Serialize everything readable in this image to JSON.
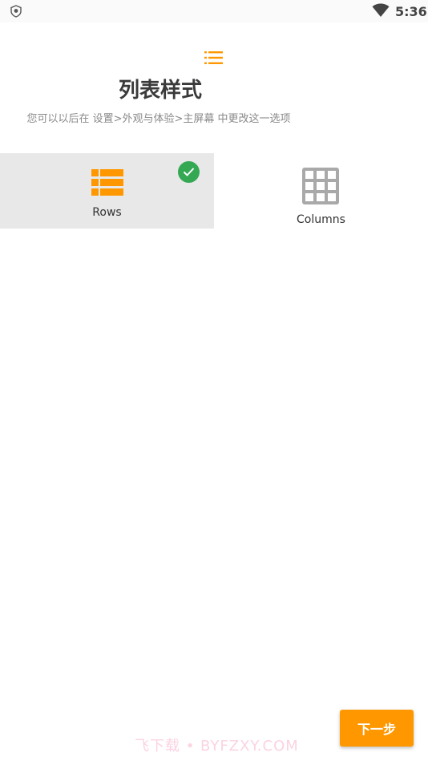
{
  "status_bar": {
    "time": "5:36",
    "left_icon": "shield-icon",
    "wifi_icon": "wifi-icon"
  },
  "header": {
    "icon": "list-icon",
    "title": "列表样式",
    "subtitle": "您可以以后在 设置>外观与体验>主屏幕 中更改这一选项"
  },
  "options": [
    {
      "label": "Rows",
      "icon": "rows-icon",
      "selected": true
    },
    {
      "label": "Columns",
      "icon": "grid-icon",
      "selected": false
    }
  ],
  "next_button": {
    "label": "下一步"
  },
  "watermark": "飞下载 • BYFZXY.COM",
  "colors": {
    "accent": "#ff9800",
    "selected_bg": "#e8e8e8",
    "check": "#34a853",
    "grid_icon": "#a9a9a9",
    "title": "#3a3a3a",
    "subtitle": "#8a8a8a"
  }
}
